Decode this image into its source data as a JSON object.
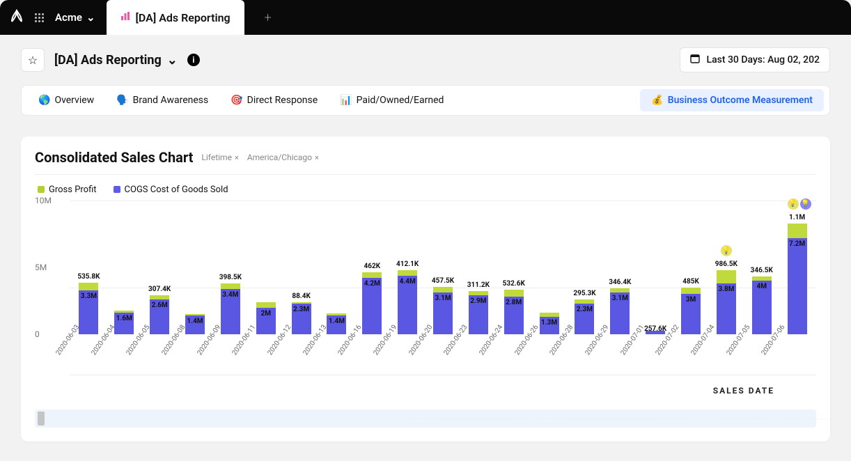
{
  "topbar": {
    "workspace": "Acme",
    "tab_label": "[DA] Ads Reporting"
  },
  "header": {
    "page_title": "[DA] Ads Reporting",
    "date_label": "Last 30 Days: Aug 02, 202"
  },
  "nav_tabs": {
    "overview": "Overview",
    "brand": "Brand Awareness",
    "direct": "Direct Response",
    "paid": "Paid/Owned/Earned",
    "business": "Business Outcome Measurement",
    "overview_icon": "🌎",
    "brand_icon": "🗣️",
    "direct_icon": "🎯",
    "paid_icon": "📊",
    "business_icon": "💰"
  },
  "card": {
    "title": "Consolidated Sales Chart",
    "chip1": "Lifetime",
    "chip2": "America/Chicago",
    "legend_profit": "Gross Profit",
    "legend_cogs": "COGS Cost of Goods Sold",
    "yticks": {
      "a": "10M",
      "b": "5M",
      "c": "0"
    },
    "axis_title": "SALES DATE"
  },
  "chart_data": {
    "type": "bar",
    "title": "Consolidated Sales Chart",
    "xlabel": "SALES DATE",
    "ylabel": "",
    "ylim": [
      0,
      10000000
    ],
    "categories": [
      "2020-06-03",
      "2020-06-04",
      "2020-06-05",
      "2020-06-08",
      "2020-06-09",
      "2020-06-11",
      "2020-06-12",
      "2020-06-13",
      "2020-06-16",
      "2020-06-19",
      "2020-06-20",
      "2020-06-23",
      "2020-06-24",
      "2020-06-26",
      "2020-06-28",
      "2020-06-29",
      "2020-07-01",
      "2020-07-02",
      "2020-07-04",
      "2020-07-05",
      "2020-07-06"
    ],
    "series": [
      {
        "name": "COGS Cost of Goods Sold",
        "color": "#5a57e3",
        "values": [
          3300000,
          1600000,
          2600000,
          1400000,
          3400000,
          2000000,
          2300000,
          1400000,
          4200000,
          4400000,
          3100000,
          2900000,
          2800000,
          1300000,
          2300000,
          3100000,
          257600,
          3000000,
          3800000,
          4000000,
          7200000
        ],
        "labels": [
          "3.3M",
          "1.6M",
          "2.6M",
          "1.4M",
          "3.4M",
          "2M",
          "2.3M",
          "1.4M",
          "4.2M",
          "4.4M",
          "3.1M",
          "2.9M",
          "2.8M",
          "1.3M",
          "2.3M",
          "3.1M",
          "257.6K",
          "3M",
          "3.8M",
          "4M",
          "7.2M"
        ]
      },
      {
        "name": "Gross Profit",
        "color": "#c0d93b",
        "values": [
          535800,
          150000,
          307400,
          130000,
          398500,
          380000,
          88400,
          140000,
          462000,
          412100,
          457500,
          311200,
          532600,
          300000,
          295300,
          346400,
          0,
          485000,
          986500,
          346500,
          1100000
        ],
        "labels": [
          "535.8K",
          "",
          "307.4K",
          "",
          "398.5K",
          "",
          "88.4K",
          "",
          "462K",
          "412.1K",
          "457.5K",
          "311.2K",
          "532.6K",
          "",
          "295.3K",
          "346.4K",
          "",
          "485K",
          "986.5K",
          "346.5K",
          "1.1M"
        ]
      }
    ],
    "annotations": [
      {
        "index": 18,
        "icon": "bulb",
        "color": "#e8e06a"
      },
      {
        "index": 20,
        "icon": "bulb",
        "color": "#e8e06a"
      },
      {
        "index": 20,
        "icon": "bulb",
        "color": "#8a86f0"
      }
    ]
  }
}
